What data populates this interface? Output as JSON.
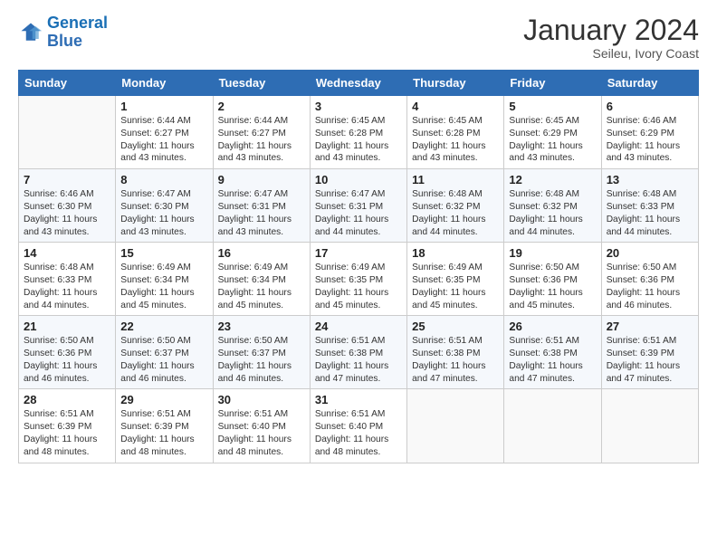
{
  "logo": {
    "line1": "General",
    "line2": "Blue"
  },
  "title": "January 2024",
  "subtitle": "Seileu, Ivory Coast",
  "days_of_week": [
    "Sunday",
    "Monday",
    "Tuesday",
    "Wednesday",
    "Thursday",
    "Friday",
    "Saturday"
  ],
  "weeks": [
    [
      {
        "day": "",
        "sunrise": "",
        "sunset": "",
        "daylight": ""
      },
      {
        "day": "1",
        "sunrise": "Sunrise: 6:44 AM",
        "sunset": "Sunset: 6:27 PM",
        "daylight": "Daylight: 11 hours and 43 minutes."
      },
      {
        "day": "2",
        "sunrise": "Sunrise: 6:44 AM",
        "sunset": "Sunset: 6:27 PM",
        "daylight": "Daylight: 11 hours and 43 minutes."
      },
      {
        "day": "3",
        "sunrise": "Sunrise: 6:45 AM",
        "sunset": "Sunset: 6:28 PM",
        "daylight": "Daylight: 11 hours and 43 minutes."
      },
      {
        "day": "4",
        "sunrise": "Sunrise: 6:45 AM",
        "sunset": "Sunset: 6:28 PM",
        "daylight": "Daylight: 11 hours and 43 minutes."
      },
      {
        "day": "5",
        "sunrise": "Sunrise: 6:45 AM",
        "sunset": "Sunset: 6:29 PM",
        "daylight": "Daylight: 11 hours and 43 minutes."
      },
      {
        "day": "6",
        "sunrise": "Sunrise: 6:46 AM",
        "sunset": "Sunset: 6:29 PM",
        "daylight": "Daylight: 11 hours and 43 minutes."
      }
    ],
    [
      {
        "day": "7",
        "sunrise": "Sunrise: 6:46 AM",
        "sunset": "Sunset: 6:30 PM",
        "daylight": "Daylight: 11 hours and 43 minutes."
      },
      {
        "day": "8",
        "sunrise": "Sunrise: 6:47 AM",
        "sunset": "Sunset: 6:30 PM",
        "daylight": "Daylight: 11 hours and 43 minutes."
      },
      {
        "day": "9",
        "sunrise": "Sunrise: 6:47 AM",
        "sunset": "Sunset: 6:31 PM",
        "daylight": "Daylight: 11 hours and 43 minutes."
      },
      {
        "day": "10",
        "sunrise": "Sunrise: 6:47 AM",
        "sunset": "Sunset: 6:31 PM",
        "daylight": "Daylight: 11 hours and 44 minutes."
      },
      {
        "day": "11",
        "sunrise": "Sunrise: 6:48 AM",
        "sunset": "Sunset: 6:32 PM",
        "daylight": "Daylight: 11 hours and 44 minutes."
      },
      {
        "day": "12",
        "sunrise": "Sunrise: 6:48 AM",
        "sunset": "Sunset: 6:32 PM",
        "daylight": "Daylight: 11 hours and 44 minutes."
      },
      {
        "day": "13",
        "sunrise": "Sunrise: 6:48 AM",
        "sunset": "Sunset: 6:33 PM",
        "daylight": "Daylight: 11 hours and 44 minutes."
      }
    ],
    [
      {
        "day": "14",
        "sunrise": "Sunrise: 6:48 AM",
        "sunset": "Sunset: 6:33 PM",
        "daylight": "Daylight: 11 hours and 44 minutes."
      },
      {
        "day": "15",
        "sunrise": "Sunrise: 6:49 AM",
        "sunset": "Sunset: 6:34 PM",
        "daylight": "Daylight: 11 hours and 45 minutes."
      },
      {
        "day": "16",
        "sunrise": "Sunrise: 6:49 AM",
        "sunset": "Sunset: 6:34 PM",
        "daylight": "Daylight: 11 hours and 45 minutes."
      },
      {
        "day": "17",
        "sunrise": "Sunrise: 6:49 AM",
        "sunset": "Sunset: 6:35 PM",
        "daylight": "Daylight: 11 hours and 45 minutes."
      },
      {
        "day": "18",
        "sunrise": "Sunrise: 6:49 AM",
        "sunset": "Sunset: 6:35 PM",
        "daylight": "Daylight: 11 hours and 45 minutes."
      },
      {
        "day": "19",
        "sunrise": "Sunrise: 6:50 AM",
        "sunset": "Sunset: 6:36 PM",
        "daylight": "Daylight: 11 hours and 45 minutes."
      },
      {
        "day": "20",
        "sunrise": "Sunrise: 6:50 AM",
        "sunset": "Sunset: 6:36 PM",
        "daylight": "Daylight: 11 hours and 46 minutes."
      }
    ],
    [
      {
        "day": "21",
        "sunrise": "Sunrise: 6:50 AM",
        "sunset": "Sunset: 6:36 PM",
        "daylight": "Daylight: 11 hours and 46 minutes."
      },
      {
        "day": "22",
        "sunrise": "Sunrise: 6:50 AM",
        "sunset": "Sunset: 6:37 PM",
        "daylight": "Daylight: 11 hours and 46 minutes."
      },
      {
        "day": "23",
        "sunrise": "Sunrise: 6:50 AM",
        "sunset": "Sunset: 6:37 PM",
        "daylight": "Daylight: 11 hours and 46 minutes."
      },
      {
        "day": "24",
        "sunrise": "Sunrise: 6:51 AM",
        "sunset": "Sunset: 6:38 PM",
        "daylight": "Daylight: 11 hours and 47 minutes."
      },
      {
        "day": "25",
        "sunrise": "Sunrise: 6:51 AM",
        "sunset": "Sunset: 6:38 PM",
        "daylight": "Daylight: 11 hours and 47 minutes."
      },
      {
        "day": "26",
        "sunrise": "Sunrise: 6:51 AM",
        "sunset": "Sunset: 6:38 PM",
        "daylight": "Daylight: 11 hours and 47 minutes."
      },
      {
        "day": "27",
        "sunrise": "Sunrise: 6:51 AM",
        "sunset": "Sunset: 6:39 PM",
        "daylight": "Daylight: 11 hours and 47 minutes."
      }
    ],
    [
      {
        "day": "28",
        "sunrise": "Sunrise: 6:51 AM",
        "sunset": "Sunset: 6:39 PM",
        "daylight": "Daylight: 11 hours and 48 minutes."
      },
      {
        "day": "29",
        "sunrise": "Sunrise: 6:51 AM",
        "sunset": "Sunset: 6:39 PM",
        "daylight": "Daylight: 11 hours and 48 minutes."
      },
      {
        "day": "30",
        "sunrise": "Sunrise: 6:51 AM",
        "sunset": "Sunset: 6:40 PM",
        "daylight": "Daylight: 11 hours and 48 minutes."
      },
      {
        "day": "31",
        "sunrise": "Sunrise: 6:51 AM",
        "sunset": "Sunset: 6:40 PM",
        "daylight": "Daylight: 11 hours and 48 minutes."
      },
      {
        "day": "",
        "sunrise": "",
        "sunset": "",
        "daylight": ""
      },
      {
        "day": "",
        "sunrise": "",
        "sunset": "",
        "daylight": ""
      },
      {
        "day": "",
        "sunrise": "",
        "sunset": "",
        "daylight": ""
      }
    ]
  ]
}
